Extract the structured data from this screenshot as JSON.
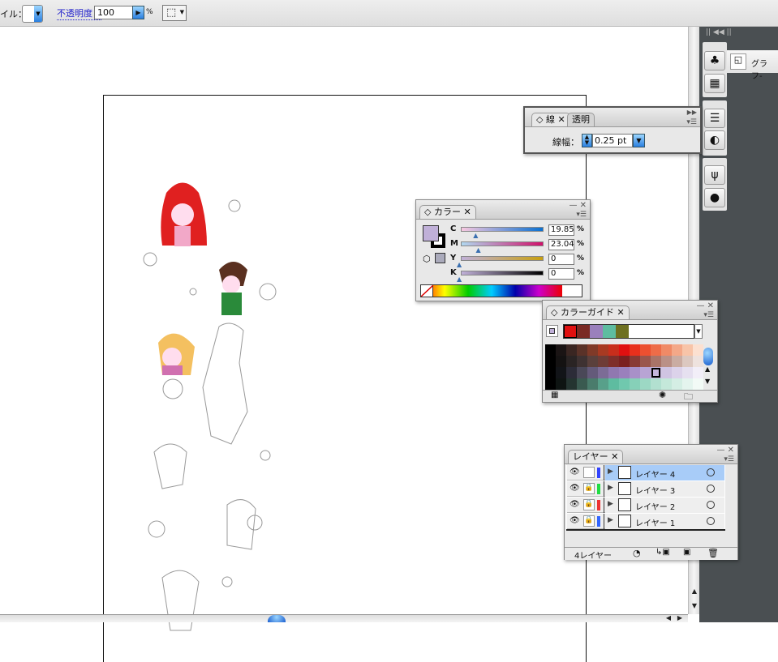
{
  "toolbar": {
    "style_label": "イル：",
    "opacity_label": "不透明度：",
    "opacity_value": "100",
    "percent": "%"
  },
  "stroke_panel": {
    "tabs": [
      "線",
      "透明"
    ],
    "weight_label": "線幅：",
    "weight_value": "0.25 pt"
  },
  "color_panel": {
    "title": "カラー",
    "fill_color": "#c0b0d8",
    "channels": [
      {
        "label": "C",
        "value": "19.85",
        "fraction": 0.1985
      },
      {
        "label": "M",
        "value": "23.04",
        "fraction": 0.2304
      },
      {
        "label": "Y",
        "value": "0",
        "fraction": 0
      },
      {
        "label": "K",
        "value": "0",
        "fraction": 0
      }
    ],
    "percent": "%"
  },
  "color_guide": {
    "title": "カラーガイド",
    "harmony": [
      "#e01010",
      "#7a2a24",
      "#9a80bc",
      "#5ebca0",
      "#6e7020"
    ],
    "grid": [
      [
        "#000000",
        "#1a1414",
        "#3a2622",
        "#5a3228",
        "#803a28",
        "#a83a22",
        "#c82e1c",
        "#e01010",
        "#e8301c",
        "#ec5030",
        "#ee6c48",
        "#f08a66",
        "#f4a888",
        "#f8c4a8",
        "#fce0d0"
      ],
      [
        "#000000",
        "#141212",
        "#2a2424",
        "#3e3232",
        "#5a403c",
        "#6e3c36",
        "#7e2e2a",
        "#7a2020",
        "#883a34",
        "#9a564c",
        "#aa7468",
        "#ba9086",
        "#caaca2",
        "#dcc8c0",
        "#eee2de"
      ],
      [
        "#000000",
        "#121418",
        "#2c2c38",
        "#4a4858",
        "#645a7a",
        "#7c6c96",
        "#9078b0",
        "#9a80bc",
        "#a890c8",
        "#b8a4d4",
        "#c6b6dc",
        "#d0c4e2",
        "#dcd2ea",
        "#e6e0f0",
        "#f2eef8"
      ],
      [
        "#000000",
        "#0e1412",
        "#243430",
        "#3a5a50",
        "#4a7c6c",
        "#58a08a",
        "#5ebca0",
        "#70c8ae",
        "#86d0b8",
        "#9cd8c4",
        "#b2e0d0",
        "#c4e8da",
        "#d4eee4",
        "#e4f4ee",
        "#f2faf6"
      ]
    ]
  },
  "layers_panel": {
    "title": "レイヤー",
    "count_label": "4レイヤー",
    "layers": [
      {
        "name": "レイヤー 4",
        "color": "#3344ff",
        "locked": false,
        "selected": true
      },
      {
        "name": "レイヤー 3",
        "color": "#22dd44",
        "locked": true,
        "selected": false
      },
      {
        "name": "レイヤー 2",
        "color": "#ee3333",
        "locked": true,
        "selected": false
      },
      {
        "name": "レイヤー 1",
        "color": "#3366ff",
        "locked": true,
        "selected": false
      }
    ]
  },
  "dock": {
    "graph_label": "グラフ-"
  }
}
